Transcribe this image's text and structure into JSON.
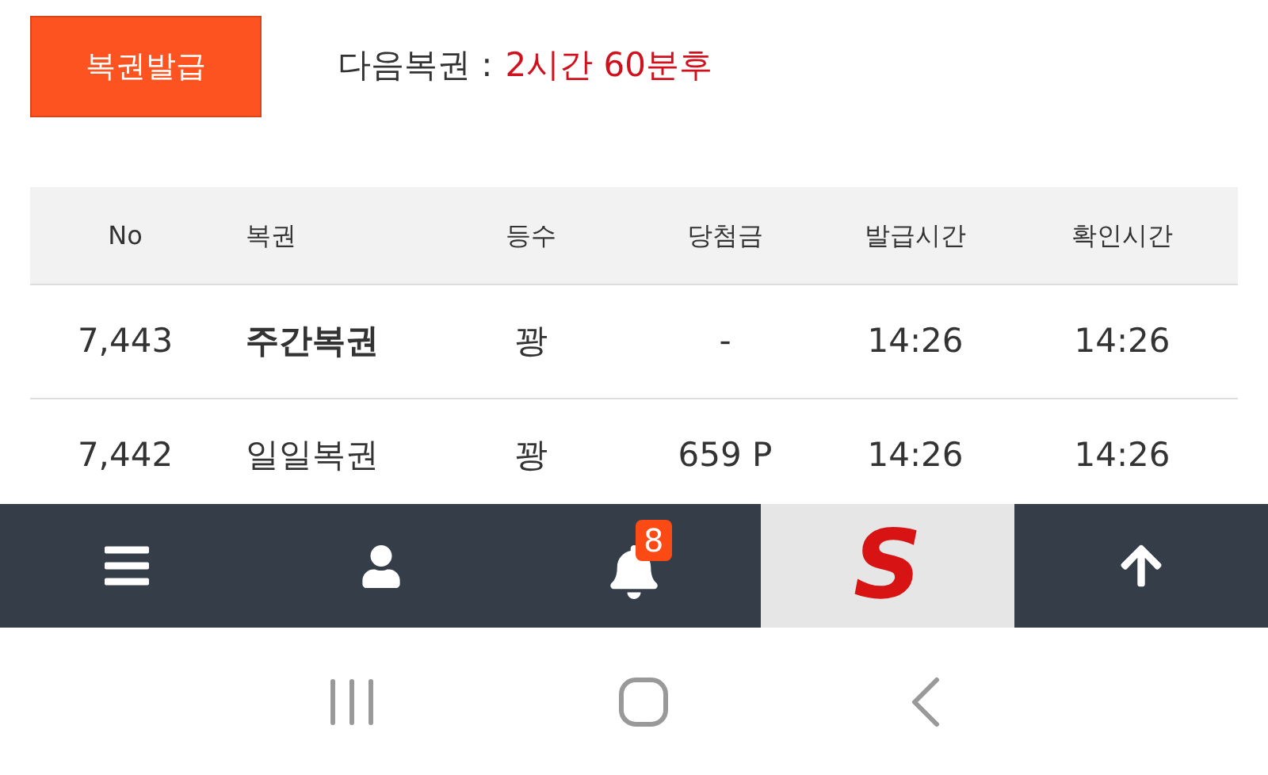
{
  "issue_button": "복권발급",
  "next": {
    "label": "다음복권 :",
    "value": "2시간 60분후"
  },
  "table": {
    "columns": [
      "No",
      "복권",
      "등수",
      "당첨금",
      "발급시간",
      "확인시간"
    ],
    "rows": [
      {
        "cells": [
          "7,443",
          "주간복권",
          "꽝",
          "-",
          "14:26",
          "14:26"
        ],
        "highlight": true
      },
      {
        "cells": [
          "7,442",
          "일일복권",
          "꽝",
          "659 P",
          "14:26",
          "14:26"
        ],
        "highlight": false
      }
    ]
  },
  "bottom_nav": [
    {
      "kind": "menu",
      "selected": false
    },
    {
      "kind": "user",
      "selected": false
    },
    {
      "kind": "bell",
      "badge": "8",
      "selected": false
    },
    {
      "kind": "logo",
      "text": "S",
      "selected": true
    },
    {
      "kind": "top",
      "selected": false
    }
  ]
}
